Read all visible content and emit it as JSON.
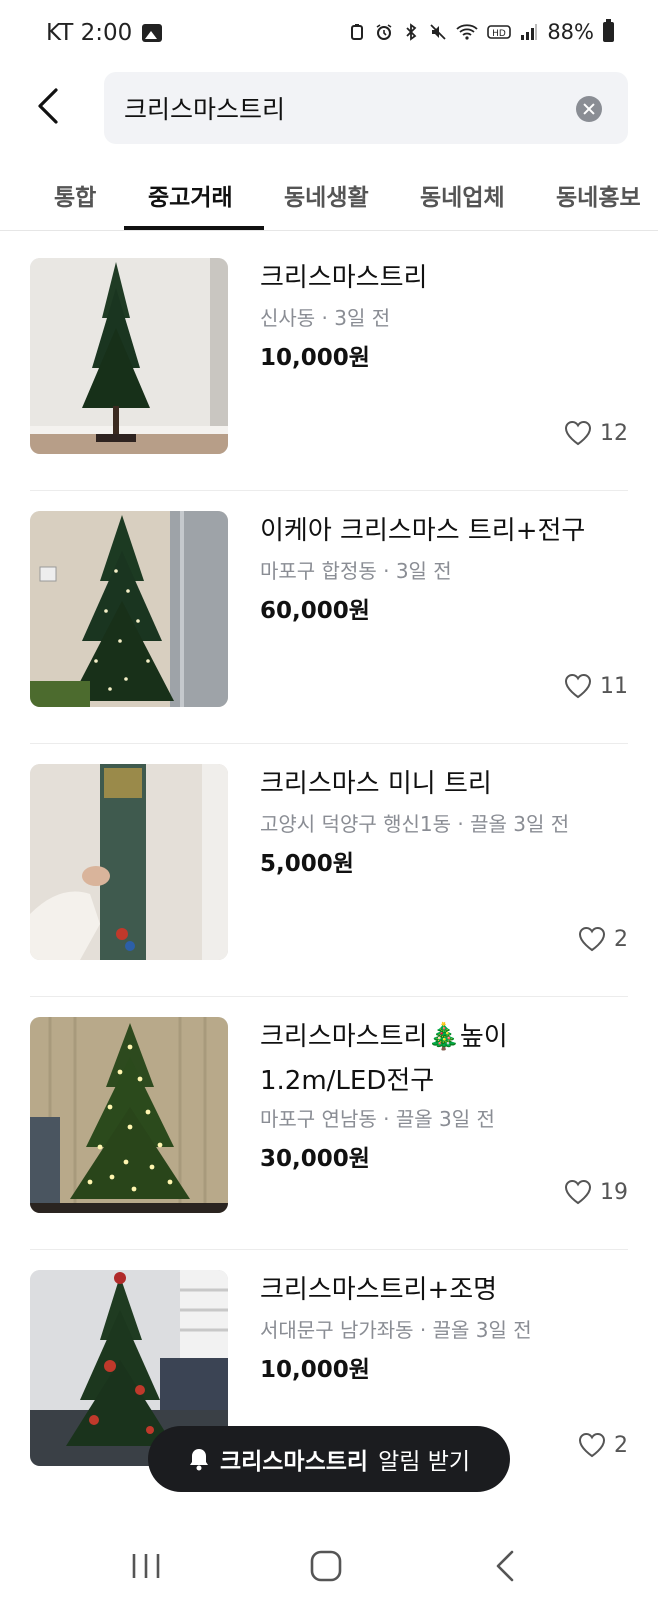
{
  "status_bar": {
    "carrier_time": "KT 2:00",
    "battery": "88%"
  },
  "search": {
    "value": "크리스마스트리",
    "placeholder": ""
  },
  "tabs": [
    {
      "label": "통합"
    },
    {
      "label": "중고거래"
    },
    {
      "label": "동네생활"
    },
    {
      "label": "동네업체"
    },
    {
      "label": "동네홍보"
    }
  ],
  "active_tab": "중고거래",
  "items": [
    {
      "title": "크리스마스트리",
      "meta": "신사동 · 3일 전",
      "price": "10,000원",
      "likes": "12",
      "thumbnail": "christmas-tree-photo"
    },
    {
      "title": "이케아 크리스마스 트리+전구",
      "meta": "마포구 합정동 · 3일 전",
      "price": "60,000원",
      "likes": "11",
      "thumbnail": "christmas-tree-lights-photo"
    },
    {
      "title": "크리스마스 미니 트리",
      "meta": "고양시 덕양구 행신1동 · 끌올 3일 전",
      "price": "5,000원",
      "likes": "2",
      "thumbnail": "boxed-mini-tree-photo"
    },
    {
      "title": "크리스마스트리🎄높이1.2m/LED전구",
      "meta": "마포구 연남동 · 끌올 3일 전",
      "price": "30,000원",
      "likes": "19",
      "thumbnail": "lit-tree-photo"
    },
    {
      "title": "크리스마스트리+조명",
      "meta": "서대문구 남가좌동 · 끌올 3일 전",
      "price": "10,000원",
      "likes": "2",
      "thumbnail": "decorated-tree-photo"
    }
  ],
  "alert_button": {
    "keyword": "크리스마스트리",
    "suffix": "알림 받기"
  },
  "colors": {
    "accent": "#111111",
    "meta_gray": "#8a8d94",
    "search_bg": "#f2f3f6",
    "alert_bg": "#1b1c1f"
  }
}
